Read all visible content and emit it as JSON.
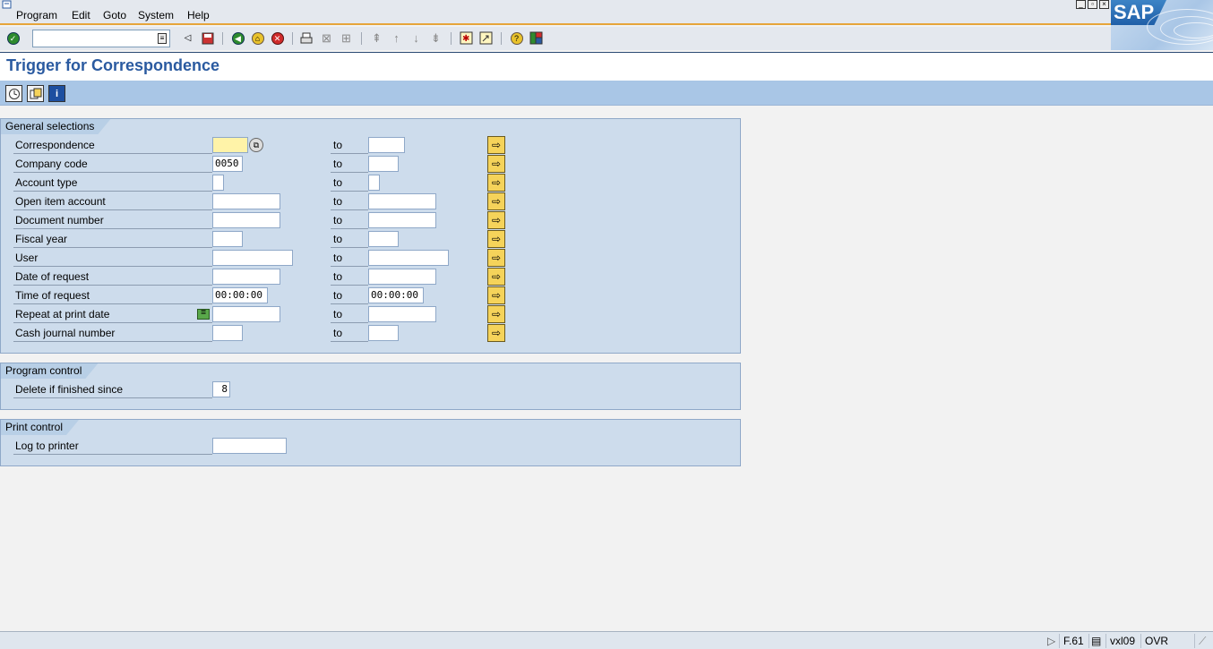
{
  "menubar": {
    "items": [
      "Program",
      "Edit",
      "Goto",
      "System",
      "Help"
    ],
    "logo_text": "SAP"
  },
  "toolbar": {
    "command_field_value": "",
    "icons": [
      "enter-icon",
      "back-icon",
      "save-icon",
      "back-nav-icon",
      "exit-icon",
      "cancel-icon",
      "print-icon",
      "find-icon",
      "find-next-icon",
      "first-page-icon",
      "previous-page-icon",
      "next-page-icon",
      "last-page-icon",
      "create-session-icon",
      "shortcut-icon",
      "help-icon",
      "layout-menu-icon"
    ]
  },
  "title": "Trigger for Correspondence",
  "app_toolbar": {
    "icons": [
      "execute-icon",
      "get-variant-icon",
      "program-documentation-icon"
    ]
  },
  "general_selections": {
    "title": "General selections",
    "to_label": "to",
    "rows": [
      {
        "label": "Correspondence",
        "from": "",
        "to": ""
      },
      {
        "label": "Company code",
        "from": "0050",
        "to": ""
      },
      {
        "label": "Account type",
        "from": "",
        "to": ""
      },
      {
        "label": "Open item account",
        "from": "",
        "to": ""
      },
      {
        "label": "Document number",
        "from": "",
        "to": ""
      },
      {
        "label": "Fiscal year",
        "from": "",
        "to": ""
      },
      {
        "label": "User",
        "from": "",
        "to": ""
      },
      {
        "label": "Date of request",
        "from": "",
        "to": ""
      },
      {
        "label": "Time of request",
        "from": "00:00:00",
        "to": "00:00:00"
      },
      {
        "label": "Repeat at print date",
        "from": "",
        "to": ""
      },
      {
        "label": "Cash journal number",
        "from": "",
        "to": ""
      }
    ]
  },
  "program_control": {
    "title": "Program control",
    "rows": [
      {
        "label": "Delete if finished since",
        "value": "8"
      }
    ]
  },
  "print_control": {
    "title": "Print control",
    "rows": [
      {
        "label": "Log to printer",
        "value": ""
      }
    ]
  },
  "statusbar": {
    "transaction": "F.61",
    "server": "vxl09",
    "mode": "OVR"
  }
}
